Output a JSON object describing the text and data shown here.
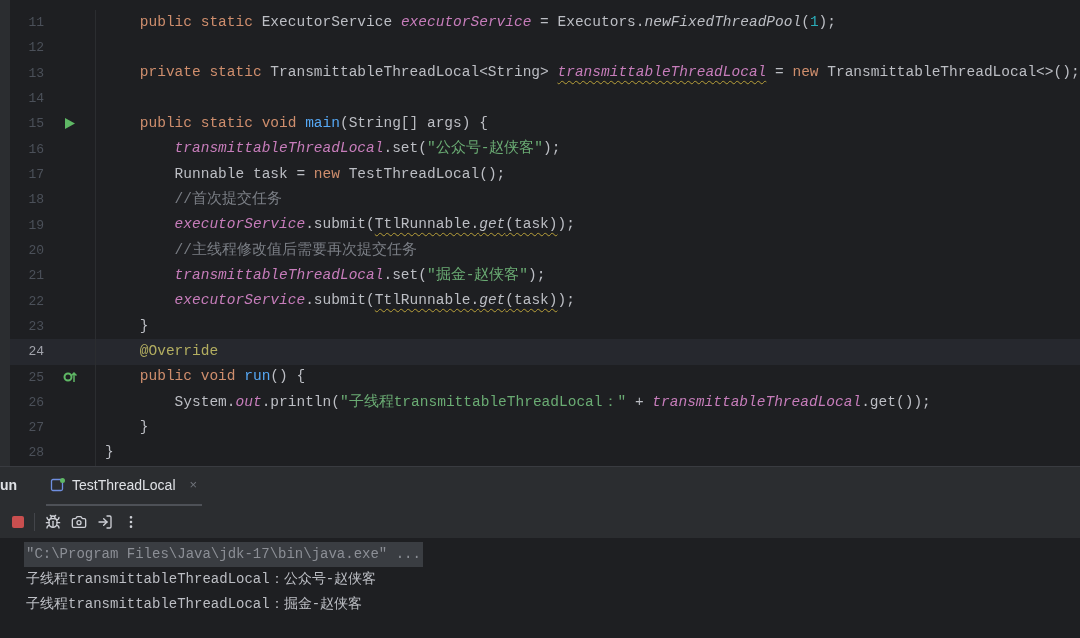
{
  "editor": {
    "lines": [
      {
        "number": "11",
        "current": false,
        "tokens": [
          {
            "text": "    public static ",
            "kind": "keyword",
            "warning": false
          },
          {
            "text": "ExecutorService ",
            "kind": "plain",
            "warning": false
          },
          {
            "text": "executorService",
            "kind": "field",
            "warning": false
          },
          {
            "text": " = Executors.",
            "kind": "plain",
            "warning": false
          },
          {
            "text": "newFixedThreadPool",
            "kind": "static-call",
            "warning": false
          },
          {
            "text": "(",
            "kind": "plain",
            "warning": false
          },
          {
            "text": "1",
            "kind": "number",
            "warning": false
          },
          {
            "text": ");",
            "kind": "plain",
            "warning": false
          }
        ]
      },
      {
        "number": "12",
        "current": false,
        "kind": "plain"
      },
      {
        "number": "13",
        "current": false,
        "tokens": [
          {
            "text": "    private static ",
            "kind": "keyword",
            "warning": false
          },
          {
            "text": "TransmittableThreadLocal<String> ",
            "kind": "plain",
            "warning": false
          },
          {
            "text": "transmittableThreadLocal",
            "kind": "field",
            "warning": true
          },
          {
            "text": " = ",
            "kind": "plain",
            "warning": false
          },
          {
            "text": "new ",
            "kind": "keyword",
            "warning": false
          },
          {
            "text": "TransmittableThreadLocal<>();",
            "kind": "plain",
            "warning": false
          }
        ]
      },
      {
        "number": "14",
        "current": false,
        "kind": "plain"
      },
      {
        "number": "15",
        "current": false,
        "kind": "run",
        "tokens": [
          {
            "text": "    public static void ",
            "kind": "keyword",
            "warning": false
          },
          {
            "text": "main",
            "kind": "declaration",
            "warning": false
          },
          {
            "text": "(String[] args) {",
            "kind": "plain",
            "warning": false
          }
        ]
      },
      {
        "number": "16",
        "current": false,
        "tokens": [
          {
            "text": "        transmittableThreadLocal",
            "kind": "field",
            "warning": false
          },
          {
            "text": ".set(",
            "kind": "plain",
            "warning": false
          },
          {
            "text": "\"公众号-赵侠客\"",
            "kind": "string",
            "warning": false
          },
          {
            "text": ");",
            "kind": "plain",
            "warning": false
          }
        ]
      },
      {
        "number": "17",
        "current": false,
        "tokens": [
          {
            "text": "        Runnable task = ",
            "kind": "plain",
            "warning": false
          },
          {
            "text": "new ",
            "kind": "keyword",
            "warning": false
          },
          {
            "text": "TestThreadLocal();",
            "kind": "plain",
            "warning": false
          }
        ]
      },
      {
        "number": "18",
        "current": false,
        "tokens": [
          {
            "text": "        //首次提交任务",
            "kind": "comment",
            "warning": false
          }
        ]
      },
      {
        "number": "19",
        "current": false,
        "tokens": [
          {
            "text": "        executorService",
            "kind": "field",
            "warning": false
          },
          {
            "text": ".submit(",
            "kind": "plain",
            "warning": false
          },
          {
            "text": "TtlRunnable.",
            "kind": "plain",
            "warning": true
          },
          {
            "text": "get",
            "kind": "static-call",
            "warning": true
          },
          {
            "text": "(task)",
            "kind": "plain",
            "warning": true
          },
          {
            "text": ");",
            "kind": "plain",
            "warning": false
          }
        ]
      },
      {
        "number": "20",
        "current": false,
        "tokens": [
          {
            "text": "        //主线程修改值后需要再次提交任务",
            "kind": "comment",
            "warning": false
          }
        ]
      },
      {
        "number": "21",
        "current": false,
        "tokens": [
          {
            "text": "        transmittableThreadLocal",
            "kind": "field",
            "warning": false
          },
          {
            "text": ".set(",
            "kind": "plain",
            "warning": false
          },
          {
            "text": "\"掘金-赵侠客\"",
            "kind": "string",
            "warning": false
          },
          {
            "text": ");",
            "kind": "plain",
            "warning": false
          }
        ]
      },
      {
        "number": "22",
        "current": false,
        "tokens": [
          {
            "text": "        executorService",
            "kind": "field",
            "warning": false
          },
          {
            "text": ".submit(",
            "kind": "plain",
            "warning": false
          },
          {
            "text": "TtlRunnable.",
            "kind": "plain",
            "warning": true
          },
          {
            "text": "get",
            "kind": "static-call",
            "warning": true
          },
          {
            "text": "(task)",
            "kind": "plain",
            "warning": true
          },
          {
            "text": ");",
            "kind": "plain",
            "warning": false
          }
        ]
      },
      {
        "number": "23",
        "current": false,
        "tokens": [
          {
            "text": "    }",
            "kind": "plain",
            "warning": false
          }
        ]
      },
      {
        "number": "24",
        "current": true,
        "tokens": [
          {
            "text": "    @Override",
            "kind": "annotation",
            "warning": false
          }
        ]
      },
      {
        "number": "25",
        "current": false,
        "kind": "override",
        "tokens": [
          {
            "text": "    public void ",
            "kind": "keyword",
            "warning": false
          },
          {
            "text": "run",
            "kind": "declaration",
            "warning": false
          },
          {
            "text": "() {",
            "kind": "plain",
            "warning": false
          }
        ]
      },
      {
        "number": "26",
        "current": false,
        "tokens": [
          {
            "text": "        System.",
            "kind": "plain",
            "warning": false
          },
          {
            "text": "out",
            "kind": "field",
            "warning": false
          },
          {
            "text": ".println(",
            "kind": "plain",
            "warning": false
          },
          {
            "text": "\"子线程transmittableThreadLocal：\"",
            "kind": "string",
            "warning": false
          },
          {
            "text": " + ",
            "kind": "plain",
            "warning": false
          },
          {
            "text": "transmittableThreadLocal",
            "kind": "field",
            "warning": false
          },
          {
            "text": ".get());",
            "kind": "plain",
            "warning": false
          }
        ]
      },
      {
        "number": "27",
        "current": false,
        "tokens": [
          {
            "text": "    }",
            "kind": "plain",
            "warning": false
          }
        ]
      },
      {
        "number": "28",
        "current": false,
        "tokens": [
          {
            "text": "}",
            "kind": "plain",
            "warning": false
          }
        ]
      }
    ]
  },
  "run_panel": {
    "label": "un",
    "tabs": [
      {
        "label": "TestThreadLocal",
        "selected": true
      }
    ],
    "close_mark": "×",
    "console": [
      {
        "text": "\"C:\\Program Files\\Java\\jdk-17\\bin\\java.exe\" ...",
        "selected": true
      },
      {
        "text": "子线程transmittableThreadLocal：公众号-赵侠客",
        "selected": false
      },
      {
        "text": "子线程transmittableThreadLocal：掘金-赵侠客",
        "selected": false
      }
    ]
  }
}
